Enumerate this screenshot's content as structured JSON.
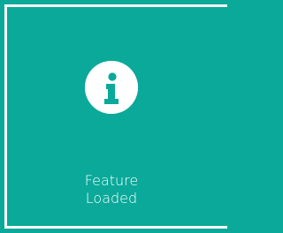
{
  "notification": {
    "icon": "info-icon",
    "line1": "Feature",
    "line2": "Loaded"
  },
  "colors": {
    "background": "#0aa99a",
    "foreground": "#ffffff"
  }
}
